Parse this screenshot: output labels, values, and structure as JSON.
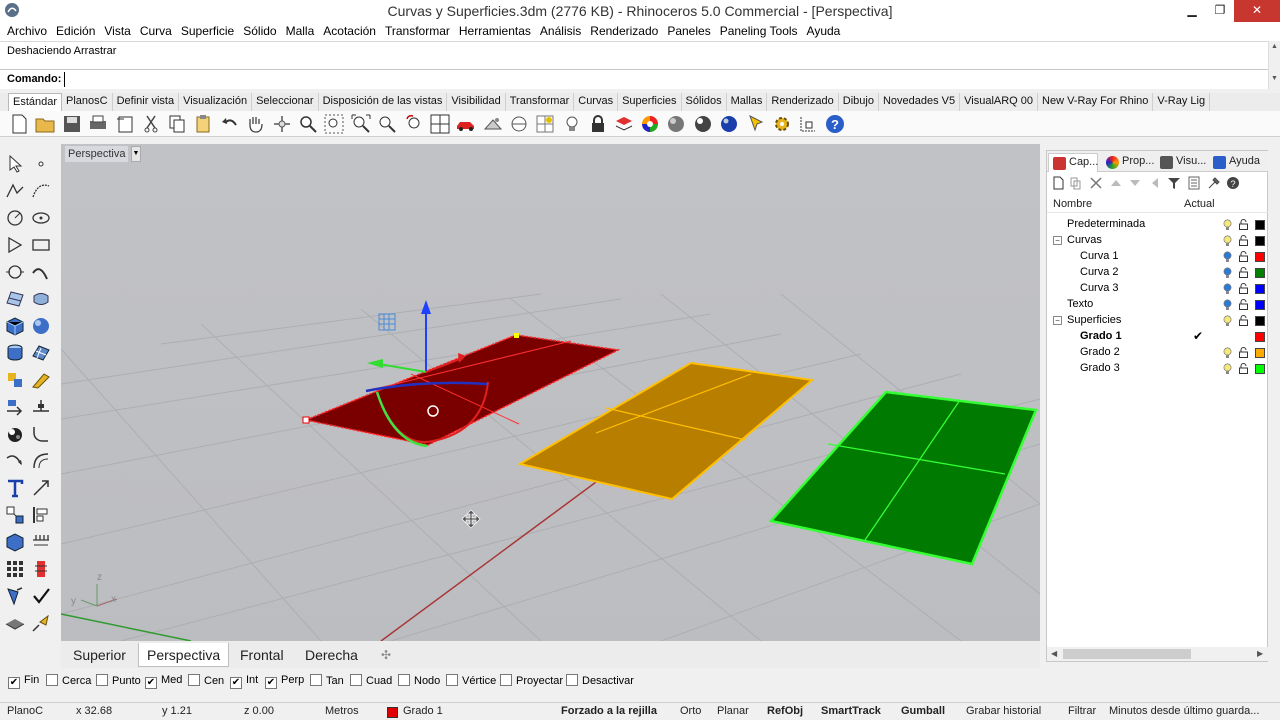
{
  "window": {
    "title": "Curvas y Superficies.3dm (2776 KB) - Rhinoceros 5.0 Commercial - [Perspectiva]",
    "minimize": "▁",
    "restore": "❐",
    "close": "✕"
  },
  "menu": [
    "Archivo",
    "Edición",
    "Vista",
    "Curva",
    "Superficie",
    "Sólido",
    "Malla",
    "Acotación",
    "Transformar",
    "Herramientas",
    "Análisis",
    "Renderizado",
    "Paneles",
    "Paneling Tools",
    "Ayuda"
  ],
  "command": {
    "history": "Deshaciendo Arrastrar",
    "label": "Comando:",
    "value": ""
  },
  "toolbar_tabs": [
    "Estándar",
    "PlanosC",
    "Definir vista",
    "Visualización",
    "Seleccionar",
    "Disposición de las vistas",
    "Visibilidad",
    "Transformar",
    "Curvas",
    "Superficies",
    "Sólidos",
    "Mallas",
    "Renderizado",
    "Dibujo",
    "Novedades V5",
    "VisualARQ 00",
    "New V-Ray For Rhino",
    "V-Ray Lig"
  ],
  "toolbar_icons": [
    "new-file-icon",
    "open-file-icon",
    "save-icon",
    "print-icon",
    "import-icon",
    "cut-icon",
    "copy-icon",
    "paste-icon",
    "undo-icon",
    "pan-hand-icon",
    "rotate-view-icon",
    "zoom-icon",
    "zoom-window-icon",
    "zoom-extents-icon",
    "zoom-selected-icon",
    "undo-view-icon",
    "four-viewports-icon",
    "car-icon",
    "render-settings-icon",
    "cplane-icon",
    "snap-grid-icon",
    "light-bulb-icon",
    "lock-icon",
    "layer-icon",
    "color-wheel-icon",
    "sphere-shaded-icon",
    "sphere-rendered-icon",
    "sphere-blue-icon",
    "select-filter-icon",
    "settings-gear-icon",
    "dimension-icon",
    "help-icon"
  ],
  "left_tool_icons": [
    "select-arrow-icon",
    "point-icon",
    "polyline-icon",
    "curve-icon",
    "circle-icon",
    "circle-center-icon",
    "polygon-icon",
    "rectangle-icon",
    "ellipse-icon",
    "arc-icon",
    "surface-icon",
    "loft-icon",
    "box-icon",
    "sphere-solid-icon",
    "cylinder-icon",
    "mesh-icon",
    "transform-icon",
    "explode-icon",
    "move-icon",
    "trim-icon",
    "boolean-icon",
    "fillet-icon",
    "curve-tools-icon",
    "split-icon",
    "text-icon",
    "dimension-tool-icon",
    "array-icon",
    "align-icon",
    "block-icon",
    "render-icon",
    "grid-array-icon",
    "analyze-icon",
    "brush-icon",
    "check-icon",
    "group-icon",
    "edit-points-icon"
  ],
  "viewport": {
    "name": "Perspectiva",
    "axis_x": "x",
    "axis_y": "y",
    "axis_z": "z",
    "tabs": [
      "Superior",
      "Perspectiva",
      "Frontal",
      "Derecha"
    ],
    "active_tab": "Perspectiva",
    "add_tab": "✣"
  },
  "panel": {
    "tabs": [
      "Cap...",
      "Prop...",
      "Visu...",
      "Ayuda"
    ],
    "col_name": "Nombre",
    "col_current": "Actual",
    "layers": [
      {
        "name": "Predeterminada",
        "indent": 0,
        "color": "#000000",
        "bulb": "on",
        "current": false
      },
      {
        "name": "Curvas",
        "indent": 0,
        "expander": "−",
        "color": "#000000",
        "bulb": "on",
        "current": false
      },
      {
        "name": "Curva 1",
        "indent": 1,
        "color": "#ff0000",
        "bulb": "blue",
        "current": false
      },
      {
        "name": "Curva 2",
        "indent": 1,
        "color": "#008000",
        "bulb": "blue",
        "current": false
      },
      {
        "name": "Curva 3",
        "indent": 1,
        "color": "#0000ff",
        "bulb": "blue",
        "current": false
      },
      {
        "name": "Texto",
        "indent": 0,
        "color": "#0000ff",
        "bulb": "blue",
        "current": false
      },
      {
        "name": "Superficies",
        "indent": 0,
        "expander": "−",
        "color": "#000000",
        "bulb": "on",
        "current": false
      },
      {
        "name": "Grado 1",
        "indent": 1,
        "color": "#ff0000",
        "bulb": "none",
        "current": true,
        "mark": "✔"
      },
      {
        "name": "Grado 2",
        "indent": 1,
        "color": "#ffaa00",
        "bulb": "on",
        "current": false
      },
      {
        "name": "Grado 3",
        "indent": 1,
        "color": "#00ff00",
        "bulb": "on",
        "current": false
      }
    ]
  },
  "osnaps": [
    {
      "label": "Fin",
      "checked": true
    },
    {
      "label": "Cerca",
      "checked": false
    },
    {
      "label": "Punto",
      "checked": false
    },
    {
      "label": "Med",
      "checked": true
    },
    {
      "label": "Cen",
      "checked": false
    },
    {
      "label": "Int",
      "checked": true
    },
    {
      "label": "Perp",
      "checked": true
    },
    {
      "label": "Tan",
      "checked": false
    },
    {
      "label": "Cuad",
      "checked": false
    },
    {
      "label": "Nodo",
      "checked": false
    },
    {
      "label": "Vértice",
      "checked": false
    },
    {
      "label": "Proyectar",
      "checked": false
    },
    {
      "label": "Desactivar",
      "checked": false
    }
  ],
  "status": {
    "cplane": "PlanoC",
    "x": "x 32.68",
    "y": "y 1.21",
    "z": "z 0.00",
    "units": "Metros",
    "layer": "Grado 1",
    "layer_color": "#e00000",
    "grid_snap": "Forzado a la rejilla",
    "ortho": "Orto",
    "planar": "Planar",
    "osnap": "RefObj",
    "smarttrack": "SmartTrack",
    "gumball": "Gumball",
    "history": "Grabar historial",
    "filter": "Filtrar",
    "minutes": "Minutos desde último guarda..."
  }
}
